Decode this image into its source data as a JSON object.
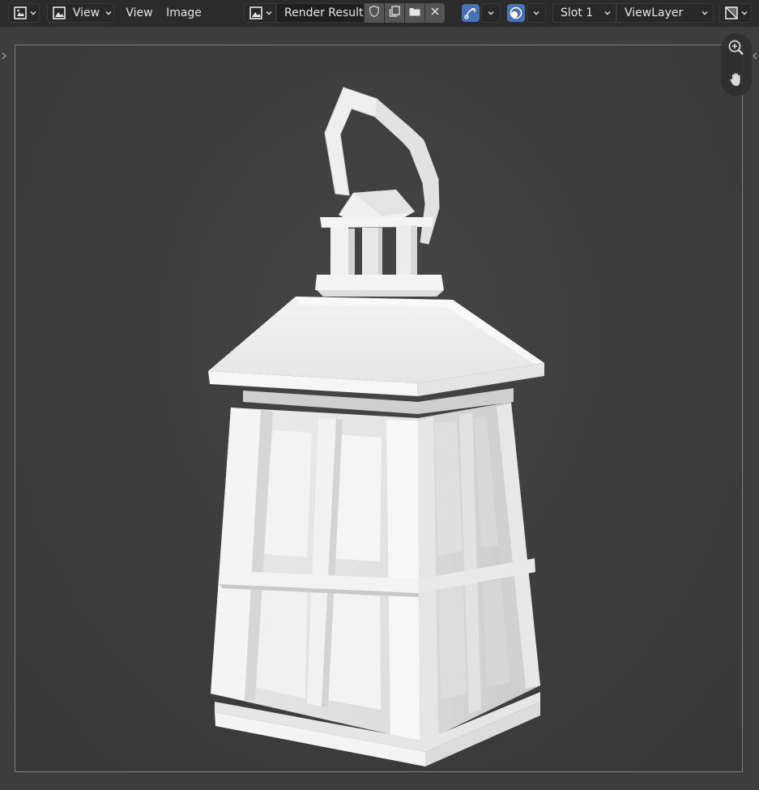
{
  "header": {
    "editor_type_icon": "image-editor-icon",
    "view_dropdown_label": "View",
    "menu": [
      "View",
      "Image"
    ],
    "image_browse_icon": "image-browse-icon",
    "image_name": "Render Result",
    "fake_user_icon": "shield-icon",
    "duplicate_icon": "duplicate-icon",
    "open_icon": "folder-icon",
    "unlink_icon": "close-icon",
    "gizmo_icon": "gizmo-icon",
    "overlay_icon": "overlay-icon",
    "slot_label": "Slot 1",
    "view_layer_label": "ViewLayer",
    "display_channels_icon": "display-channels-icon"
  },
  "viewport": {
    "zoom_icon": "zoom-in-icon",
    "pan_icon": "hand-icon",
    "background_color": "#3d3d3d",
    "accent_color": "#4772b3"
  }
}
